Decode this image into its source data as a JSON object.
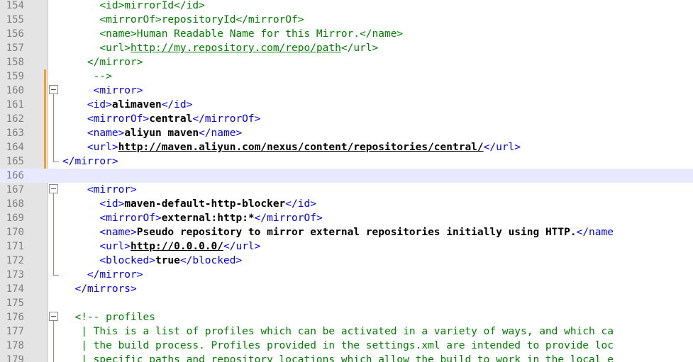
{
  "editor": {
    "colors": {
      "tag": "#0000ff",
      "comment": "#008000",
      "text": "#000000",
      "line_number": "#808080",
      "gutter": "#e4e4e4",
      "change_marker": "#f0a030",
      "current_line": "#e8e8ff"
    },
    "lines": [
      {
        "num": "154",
        "indent": "      ",
        "parts": [
          {
            "t": "<id>mirrorId</id>",
            "c": "cmt"
          }
        ]
      },
      {
        "num": "155",
        "indent": "      ",
        "parts": [
          {
            "t": "<mirrorOf>repositoryId</mirrorOf>",
            "c": "cmt"
          }
        ]
      },
      {
        "num": "156",
        "indent": "      ",
        "parts": [
          {
            "t": "<name>Human Readable Name for this Mirror.</name>",
            "c": "cmt"
          }
        ]
      },
      {
        "num": "157",
        "indent": "      ",
        "parts": [
          {
            "t": "<url>",
            "c": "cmt"
          },
          {
            "t": "http://my.repository.com/repo/path",
            "c": "cmt link"
          },
          {
            "t": "</url>",
            "c": "cmt"
          }
        ]
      },
      {
        "num": "158",
        "indent": "    ",
        "parts": [
          {
            "t": "</mirror>",
            "c": "cmt"
          }
        ]
      },
      {
        "num": "159",
        "indent": "     ",
        "parts": [
          {
            "t": "-->",
            "c": "cmt"
          }
        ]
      },
      {
        "num": "160",
        "indent": "     ",
        "parts": [
          {
            "t": "<mirror>",
            "c": "tag"
          }
        ],
        "fold": "box"
      },
      {
        "num": "161",
        "indent": "    ",
        "parts": [
          {
            "t": "<id>",
            "c": "tag"
          },
          {
            "t": "alimaven",
            "c": "txt b"
          },
          {
            "t": "</id>",
            "c": "tag"
          }
        ]
      },
      {
        "num": "162",
        "indent": "    ",
        "parts": [
          {
            "t": "<mirrorOf>",
            "c": "tag"
          },
          {
            "t": "central",
            "c": "txt b"
          },
          {
            "t": "</mirrorOf>",
            "c": "tag"
          }
        ]
      },
      {
        "num": "163",
        "indent": "    ",
        "parts": [
          {
            "t": "<name>",
            "c": "tag"
          },
          {
            "t": "aliyun maven",
            "c": "txt b"
          },
          {
            "t": "</name>",
            "c": "tag"
          }
        ]
      },
      {
        "num": "164",
        "indent": "    ",
        "parts": [
          {
            "t": "<url>",
            "c": "tag"
          },
          {
            "t": "http://maven.aliyun.com/nexus/content/repositories/central/",
            "c": "txt b link"
          },
          {
            "t": "</url>",
            "c": "tag"
          }
        ]
      },
      {
        "num": "165",
        "indent": "",
        "parts": [
          {
            "t": "</mirror>",
            "c": "tag"
          }
        ],
        "fold": "end"
      },
      {
        "num": "166",
        "indent": "",
        "parts": [],
        "current": true
      },
      {
        "num": "167",
        "indent": "    ",
        "parts": [
          {
            "t": "<mirror>",
            "c": "tag"
          }
        ],
        "fold": "box"
      },
      {
        "num": "168",
        "indent": "      ",
        "parts": [
          {
            "t": "<id>",
            "c": "tag"
          },
          {
            "t": "maven-default-http-blocker",
            "c": "txt b"
          },
          {
            "t": "</id>",
            "c": "tag"
          }
        ]
      },
      {
        "num": "169",
        "indent": "      ",
        "parts": [
          {
            "t": "<mirrorOf>",
            "c": "tag"
          },
          {
            "t": "external:http:*",
            "c": "txt b"
          },
          {
            "t": "</mirrorOf>",
            "c": "tag"
          }
        ]
      },
      {
        "num": "170",
        "indent": "      ",
        "parts": [
          {
            "t": "<name>",
            "c": "tag"
          },
          {
            "t": "Pseudo repository to mirror external repositories initially using HTTP.",
            "c": "txt b"
          },
          {
            "t": "</name",
            "c": "tag"
          }
        ]
      },
      {
        "num": "171",
        "indent": "      ",
        "parts": [
          {
            "t": "<url>",
            "c": "tag"
          },
          {
            "t": "http://0.0.0.0/",
            "c": "txt b link"
          },
          {
            "t": "</url>",
            "c": "tag"
          }
        ]
      },
      {
        "num": "172",
        "indent": "      ",
        "parts": [
          {
            "t": "<blocked>",
            "c": "tag"
          },
          {
            "t": "true",
            "c": "txt b"
          },
          {
            "t": "</blocked>",
            "c": "tag"
          }
        ]
      },
      {
        "num": "173",
        "indent": "    ",
        "parts": [
          {
            "t": "</mirror>",
            "c": "tag"
          }
        ],
        "fold": "end"
      },
      {
        "num": "174",
        "indent": "  ",
        "parts": [
          {
            "t": "</mirrors>",
            "c": "tag"
          }
        ]
      },
      {
        "num": "175",
        "indent": "",
        "parts": []
      },
      {
        "num": "176",
        "indent": "  ",
        "parts": [
          {
            "t": "<!-- profiles",
            "c": "cmt"
          }
        ],
        "fold": "box"
      },
      {
        "num": "177",
        "indent": "   ",
        "parts": [
          {
            "t": "| This is a list of profiles which can be activated in a variety of ways, and which ca",
            "c": "cmt"
          }
        ]
      },
      {
        "num": "178",
        "indent": "   ",
        "parts": [
          {
            "t": "| the build process. Profiles provided in the settings.xml are intended to provide loc",
            "c": "cmt"
          }
        ]
      },
      {
        "num": "179",
        "indent": "   ",
        "parts": [
          {
            "t": "| specific paths and repository locations which allow the build to work in the local e",
            "c": "cmt"
          }
        ]
      }
    ]
  }
}
